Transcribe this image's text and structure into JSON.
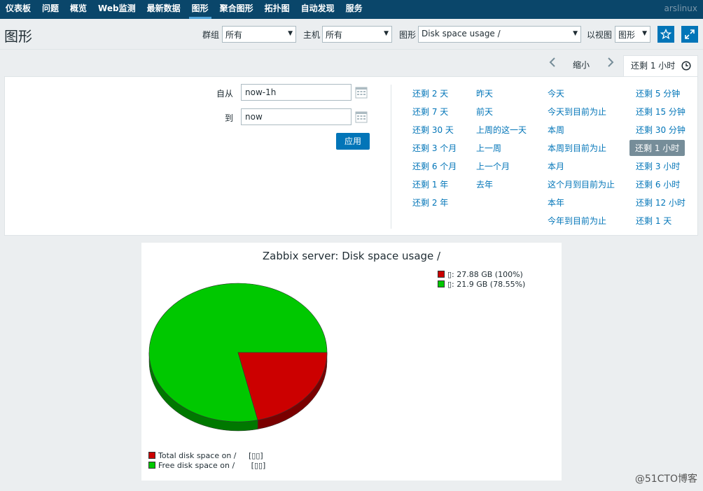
{
  "nav": {
    "items": [
      "仪表板",
      "问题",
      "概览",
      "Web监测",
      "最新数据",
      "图形",
      "聚合图形",
      "拓扑图",
      "自动发现",
      "服务"
    ],
    "active_index": 5,
    "user": "arslinux"
  },
  "header": {
    "title": "图形",
    "filters": {
      "group_label": "群组",
      "group_value": "所有",
      "host_label": "主机",
      "host_value": "所有",
      "graph_label": "图形",
      "graph_value": "Disk space usage /",
      "view_label": "以视图",
      "view_value": "图形"
    },
    "favorite_icon": "star-icon",
    "fullscreen_icon": "fullscreen-icon"
  },
  "timebar": {
    "zoom_label": "缩小",
    "tab_label": "还剩 1 小时",
    "prev_icon": "chevron-left-icon",
    "next_icon": "chevron-right-icon",
    "clock_icon": "clock-icon"
  },
  "timepanel": {
    "from_label": "自从",
    "from_value": "now-1h",
    "to_label": "到",
    "to_value": "now",
    "apply_label": "应用",
    "columns": [
      [
        "还剩 2 天",
        "还剩 7 天",
        "还剩 30 天",
        "还剩 3 个月",
        "还剩 6 个月",
        "还剩 1 年",
        "还剩 2 年"
      ],
      [
        "昨天",
        "前天",
        "上周的这一天",
        "上一周",
        "上一个月",
        "去年"
      ],
      [
        "今天",
        "今天到目前为止",
        "本周",
        "本周到目前为止",
        "本月",
        "这个月到目前为止",
        "本年",
        "今年到目前为止"
      ],
      [
        "还剩 5 分钟",
        "还剩 15 分钟",
        "还剩 30 分钟",
        "还剩 1 小时",
        "还剩 3 小时",
        "还剩 6 小时",
        "还剩 12 小时",
        "还剩 1 天"
      ]
    ],
    "selected": "还剩 1 小时"
  },
  "graph": {
    "title": "Zabbix server: Disk space usage /",
    "legend_top": [
      {
        "text": "▯: 27.88 GB (100%)",
        "color": "#cc0000"
      },
      {
        "text": "▯: 21.9 GB (78.55%)",
        "color": "#00c800"
      }
    ],
    "legend_bottom": [
      {
        "name": "Total disk space on /",
        "note": "[▯▯]",
        "color": "#cc0000"
      },
      {
        "name": "Free disk space on /",
        "note": "[▯▯]",
        "color": "#00c800"
      }
    ]
  },
  "chart_data": {
    "type": "pie",
    "title": "Zabbix server: Disk space usage /",
    "slices": [
      {
        "name": "Total disk space on /",
        "value": 27.88,
        "unit": "GB",
        "color": "#cc0000"
      },
      {
        "name": "Free disk space on /",
        "value": 21.9,
        "unit": "GB",
        "percent": 78.55,
        "color": "#00c800"
      }
    ]
  },
  "watermark": "@51CTO博客"
}
